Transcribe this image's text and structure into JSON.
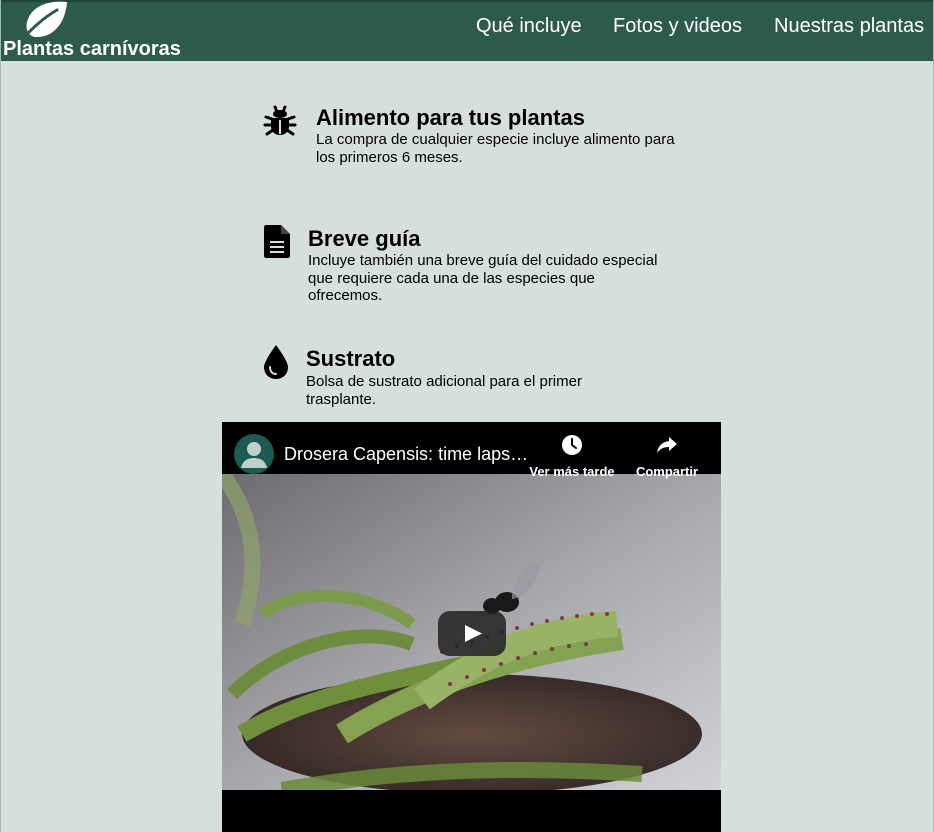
{
  "header": {
    "brand": "Plantas carnívoras",
    "nav": [
      {
        "label": "Qué incluye"
      },
      {
        "label": "Fotos y videos"
      },
      {
        "label": "Nuestras plantas"
      }
    ]
  },
  "features": [
    {
      "icon": "bug-icon",
      "title": "Alimento para tus plantas",
      "text": "La compra de cualquier especie incluye alimento para los primeros 6 meses."
    },
    {
      "icon": "document-icon",
      "title": "Breve guía",
      "text": "Incluye también una breve guía del cuidado especial que requiere cada una de las especies que ofrecemos."
    },
    {
      "icon": "water-drop-icon",
      "title": "Sustrato",
      "text": "Bolsa de sustrato adicional para el primer trasplante."
    }
  ],
  "video": {
    "title": "Drosera Capensis: time laps…",
    "watch_later": "Ver más tarde",
    "share": "Compartir"
  },
  "colors": {
    "header_bg": "#2e5a4a",
    "page_bg": "#d5e0dd"
  }
}
